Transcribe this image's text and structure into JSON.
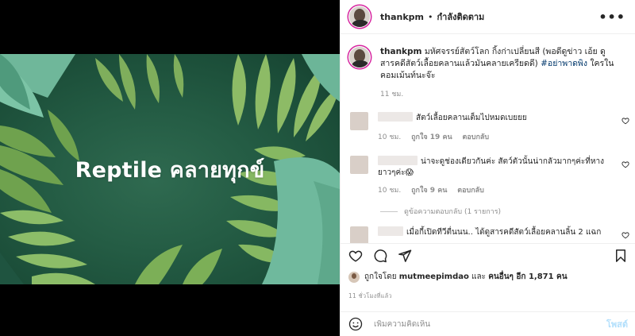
{
  "media": {
    "overlay_text": "Reptile คลายทุกข์"
  },
  "header": {
    "username": "thankpm",
    "separator": "•",
    "follow_status": "กำลังติดตาม",
    "more_label": "•••"
  },
  "caption": {
    "username": "thankpm",
    "text": "มหัศจรรย์สัตว์โลก กิ้งก่าเปลี่ยนสี (พอดีดูข่าว เอ้ย ดูสารคดีสัตว์เลื้อยคลานแล้วมันคลายเครียดดี)",
    "hashtag": "#อย่าพาดพิง",
    "text_after": "ใครในคอมเม้นท์นะจ๊ะ",
    "time": "11 ชม."
  },
  "comments": [
    {
      "text": "สัตว์เลื้อยคลานเต็มไปหมดเบยยย",
      "time": "10 ชม.",
      "likes": "ถูกใจ 19 คน",
      "reply": "ตอบกลับ"
    },
    {
      "text": "น่าจะดูช่องเดียวกันค่ะ สัตว์ตัวนั้นน่ากลัวมากๆค่ะที่หางยาวๆค่ะ😱",
      "time": "10 ชม.",
      "likes": "ถูกใจ 9 คน",
      "reply": "ตอบกลับ",
      "view_replies": "ดูข้อความตอบกลับ (1 รายการ)"
    },
    {
      "text": "เมื่อกี้เปิดทีวีตื่นนน.. ได้ดูสารคดีสัตว์เลื้อยคลานลิ้น 2 แฉก"
    }
  ],
  "likes": {
    "prefix": "ถูกใจโดย",
    "user": "mutmeepimdao",
    "middle": "และ",
    "others": "คนอื่นๆ อีก 1,871 คน"
  },
  "posted_time": "11 ชั่วโมงที่แล้ว",
  "comment_box": {
    "placeholder": "เพิ่มความคิดเห็น",
    "post_label": "โพสต์"
  },
  "colors": {
    "link": "#00376b",
    "post_button_disabled": "#b2dffc",
    "muted_text": "#8e8e8e"
  }
}
